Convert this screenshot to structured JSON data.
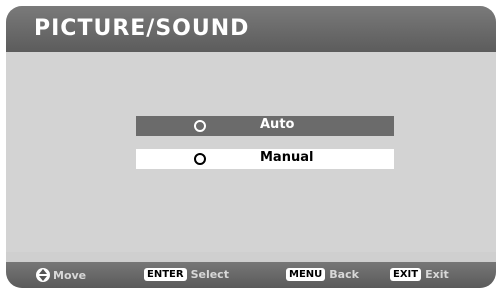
{
  "header": {
    "title": "PICTURE/SOUND"
  },
  "options": [
    {
      "label": "Auto",
      "selected": true
    },
    {
      "label": "Manual",
      "selected": false
    }
  ],
  "footer": {
    "move_label": "Move",
    "enter_key": "ENTER",
    "enter_label": "Select",
    "menu_key": "MENU",
    "menu_label": "Back",
    "exit_key": "EXIT",
    "exit_label": "Exit"
  }
}
